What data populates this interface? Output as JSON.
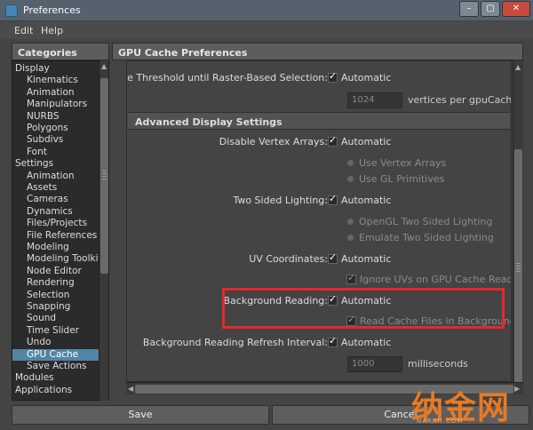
{
  "window": {
    "title": "Preferences",
    "controls": {
      "minimize": "–",
      "maximize": "▢",
      "close": "✕"
    }
  },
  "menubar": {
    "items": [
      "Edit",
      "Help"
    ]
  },
  "categories": {
    "header": "Categories",
    "items": [
      {
        "label": "Display",
        "level": 0
      },
      {
        "label": "Kinematics",
        "level": 1
      },
      {
        "label": "Animation",
        "level": 1
      },
      {
        "label": "Manipulators",
        "level": 1
      },
      {
        "label": "NURBS",
        "level": 1
      },
      {
        "label": "Polygons",
        "level": 1
      },
      {
        "label": "Subdivs",
        "level": 1
      },
      {
        "label": "Font",
        "level": 1
      },
      {
        "label": "Settings",
        "level": 0
      },
      {
        "label": "Animation",
        "level": 1
      },
      {
        "label": "Assets",
        "level": 1
      },
      {
        "label": "Cameras",
        "level": 1
      },
      {
        "label": "Dynamics",
        "level": 1
      },
      {
        "label": "Files/Projects",
        "level": 1
      },
      {
        "label": "File References",
        "level": 1
      },
      {
        "label": "Modeling",
        "level": 1
      },
      {
        "label": "Modeling Toolkit",
        "level": 1
      },
      {
        "label": "Node Editor",
        "level": 1
      },
      {
        "label": "Rendering",
        "level": 1
      },
      {
        "label": "Selection",
        "level": 1
      },
      {
        "label": "Snapping",
        "level": 1
      },
      {
        "label": "Sound",
        "level": 1
      },
      {
        "label": "Time Slider",
        "level": 1
      },
      {
        "label": "Undo",
        "level": 1
      },
      {
        "label": "GPU Cache",
        "level": 1,
        "selected": true
      },
      {
        "label": "Save Actions",
        "level": 1
      },
      {
        "label": "Modules",
        "level": 0
      },
      {
        "label": "Applications",
        "level": 0
      }
    ]
  },
  "gpu_cache": {
    "header": "GPU Cache Preferences",
    "threshold": {
      "label": "rface Threshold until Raster-Based Selection:",
      "checkbox_label": "Automatic",
      "checked": true,
      "field_value": "1024",
      "unit": "vertices per gpuCache no"
    },
    "advanced": {
      "header": "Advanced Display Settings",
      "disable_vertex_arrays": {
        "label": "Disable Vertex Arrays:",
        "checkbox_label": "Automatic",
        "checked": true,
        "options": [
          "Use Vertex Arrays",
          "Use GL Primitives"
        ]
      },
      "two_sided_lighting": {
        "label": "Two Sided Lighting:",
        "checkbox_label": "Automatic",
        "checked": true,
        "options": [
          "OpenGL Two Sided Lighting",
          "Emulate Two Sided Lighting"
        ]
      },
      "uv_coordinates": {
        "label": "UV Coordinates:",
        "checkbox_label": "Automatic",
        "checked": true,
        "sub_checkbox_label": "Ignore UVs on GPU Cache Read/Wri"
      },
      "background_reading": {
        "label": "Background Reading:",
        "checkbox_label": "Automatic",
        "checked": true,
        "sub_checkbox_label": "Read Cache Files in Background"
      },
      "refresh_interval": {
        "label": "Background Reading Refresh Interval:",
        "checkbox_label": "Automatic",
        "checked": true,
        "field_value": "1000",
        "unit": "milliseconds"
      }
    }
  },
  "buttons": {
    "save": "Save",
    "cancel": "Cancel"
  },
  "watermark": {
    "text": "纳金网",
    "sub": "NARKII.COM"
  },
  "colors": {
    "selection": "#5285a6",
    "highlight_box": "#e8262e",
    "title_bar": "#55626e"
  }
}
